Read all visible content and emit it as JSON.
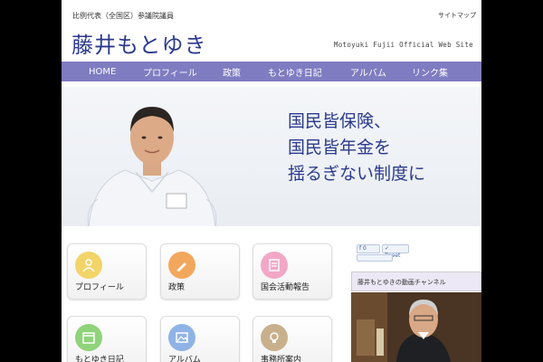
{
  "header": {
    "subtitle": "比例代表（全国区）参議院議員",
    "site_name": "藤井もとゆき",
    "tagline": "Motoyuki Fujii Official Web Site",
    "top_link": "サイトマップ"
  },
  "nav": {
    "items": [
      {
        "label": "HOME"
      },
      {
        "label": "プロフィール"
      },
      {
        "label": "政策"
      },
      {
        "label": "もとゆき日記"
      },
      {
        "label": "アルバム"
      },
      {
        "label": "リンク集"
      }
    ]
  },
  "hero": {
    "lines": [
      "国民皆保険、",
      "国民皆年金を",
      "揺るぎない制度に"
    ]
  },
  "tiles": [
    {
      "label": "プロフィール",
      "icon": "person-icon",
      "color": "#f2d468"
    },
    {
      "label": "政策",
      "icon": "pencil-icon",
      "color": "#f2a75c"
    },
    {
      "label": "国会活動報告",
      "icon": "document-icon",
      "color": "#f2a7c6"
    },
    {
      "label": "もとゆき日記",
      "icon": "calendar-icon",
      "color": "#8fd37a"
    },
    {
      "label": "アルバム",
      "icon": "photo-icon",
      "color": "#8fb3e6"
    },
    {
      "label": "事務所案内",
      "icon": "lightbulb-icon",
      "color": "#c9b08d"
    }
  ],
  "sidebar": {
    "like_count": "0",
    "tweet_label": "Tweet",
    "widget_title": "藤井もとゆきの動画チャンネル"
  },
  "colors": {
    "nav_bg": "#7f7cc1",
    "title": "#2c3a8c"
  }
}
